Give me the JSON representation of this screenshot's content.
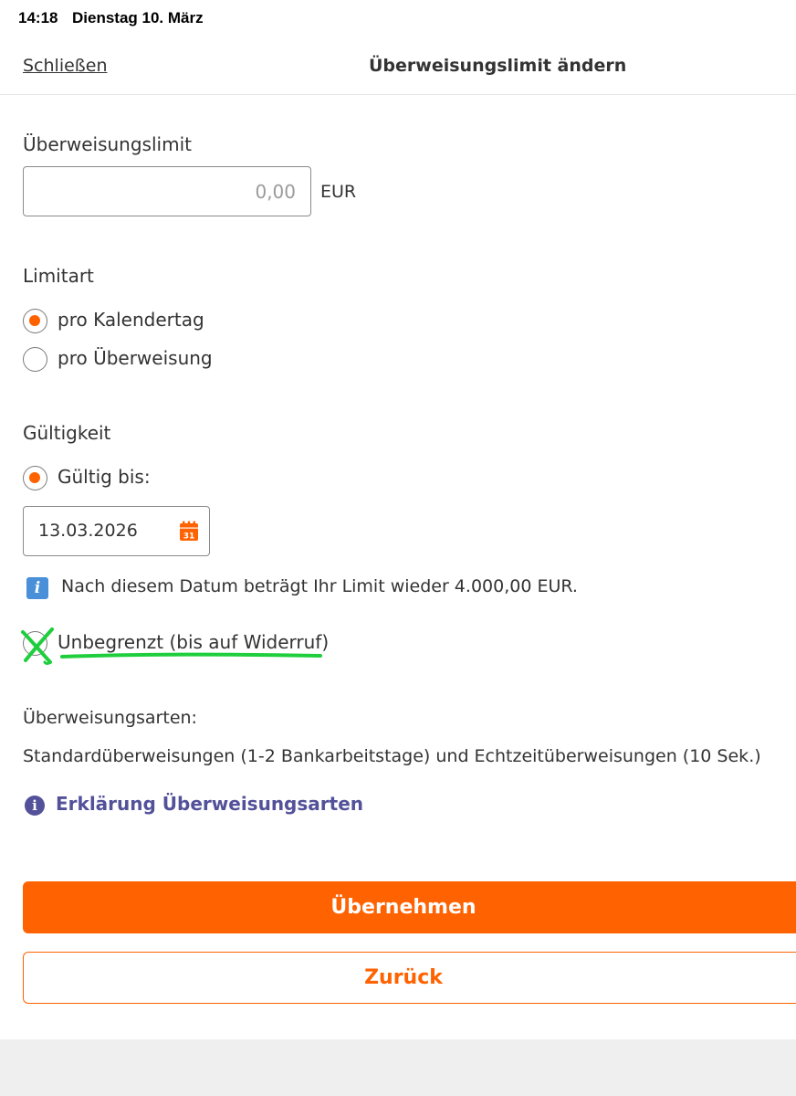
{
  "status_bar": {
    "time": "14:18",
    "date": "Dienstag 10. März"
  },
  "nav": {
    "close_label": "Schließen",
    "title": "Überweisungslimit ändern"
  },
  "limit": {
    "label": "Überweisungslimit",
    "placeholder": "0,00",
    "value": "",
    "currency": "EUR"
  },
  "limit_type": {
    "label": "Limitart",
    "options": [
      {
        "label": "pro Kalendertag",
        "selected": true
      },
      {
        "label": "pro Überweisung",
        "selected": false
      }
    ]
  },
  "validity": {
    "label": "Gültigkeit",
    "valid_until_label": "Gültig bis:",
    "valid_until_selected": true,
    "date": "13.03.2026",
    "calendar_day": "31",
    "info_text": "Nach diesem Datum beträgt Ihr Limit wieder 4.000,00 EUR.",
    "unlimited_label": "Unbegrenzt (bis auf Widerruf)",
    "unlimited_selected": false
  },
  "transfer_types": {
    "label": "Überweisungsarten:",
    "text": "Standardüberweisungen (1-2 Bankarbeitstage) und Echtzeitüberweisungen (10 Sek.)",
    "link_label": "Erklärung Überweisungsarten"
  },
  "buttons": {
    "apply_label": "Übernehmen",
    "back_label": "Zurück"
  },
  "colors": {
    "accent": "#ff6200",
    "link": "#525199",
    "info": "#4a90d9",
    "annotation": "#1fce3c"
  }
}
